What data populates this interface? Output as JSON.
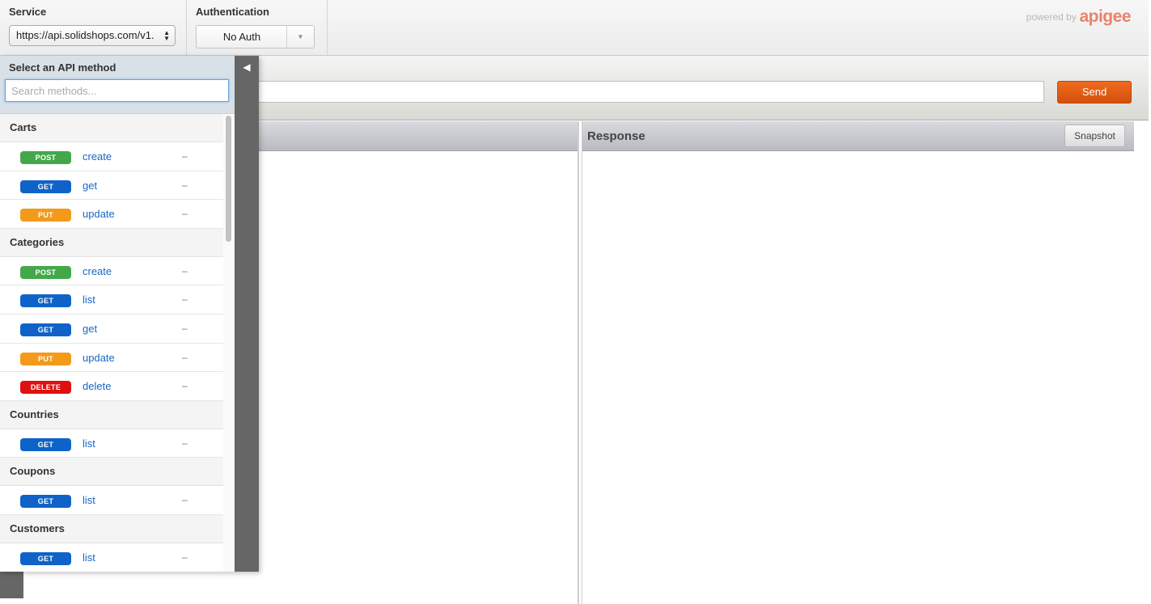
{
  "header": {
    "service_label": "Service",
    "service_value": "https://api.solidshops.com/v1.",
    "auth_label": "Authentication",
    "auth_value": "No Auth",
    "powered_by": "powered by",
    "brand": "apigee"
  },
  "request": {
    "url_value": "",
    "send_label": "Send"
  },
  "response": {
    "title": "Response",
    "snapshot_label": "Snapshot"
  },
  "drawer": {
    "title": "Select an API method",
    "search_placeholder": "Search methods...",
    "toggle_glyph": "◀",
    "groups": [
      {
        "name": "Carts",
        "methods": [
          {
            "verb": "POST",
            "name": "create",
            "desc": "–"
          },
          {
            "verb": "GET",
            "name": "get",
            "desc": "–"
          },
          {
            "verb": "PUT",
            "name": "update",
            "desc": "–"
          }
        ]
      },
      {
        "name": "Categories",
        "methods": [
          {
            "verb": "POST",
            "name": "create",
            "desc": "–"
          },
          {
            "verb": "GET",
            "name": "list",
            "desc": "–"
          },
          {
            "verb": "GET",
            "name": "get",
            "desc": "–"
          },
          {
            "verb": "PUT",
            "name": "update",
            "desc": "–"
          },
          {
            "verb": "DELETE",
            "name": "delete",
            "desc": "–"
          }
        ]
      },
      {
        "name": "Countries",
        "methods": [
          {
            "verb": "GET",
            "name": "list",
            "desc": "–"
          }
        ]
      },
      {
        "name": "Coupons",
        "methods": [
          {
            "verb": "GET",
            "name": "list",
            "desc": "–"
          }
        ]
      },
      {
        "name": "Customers",
        "methods": [
          {
            "verb": "GET",
            "name": "list",
            "desc": "–"
          }
        ]
      }
    ]
  },
  "colors": {
    "POST": "#44a84a",
    "GET": "#0f63c8",
    "PUT": "#f39a1a",
    "DELETE": "#e01010",
    "send": "#e35f15",
    "brand": "#e8836b"
  }
}
